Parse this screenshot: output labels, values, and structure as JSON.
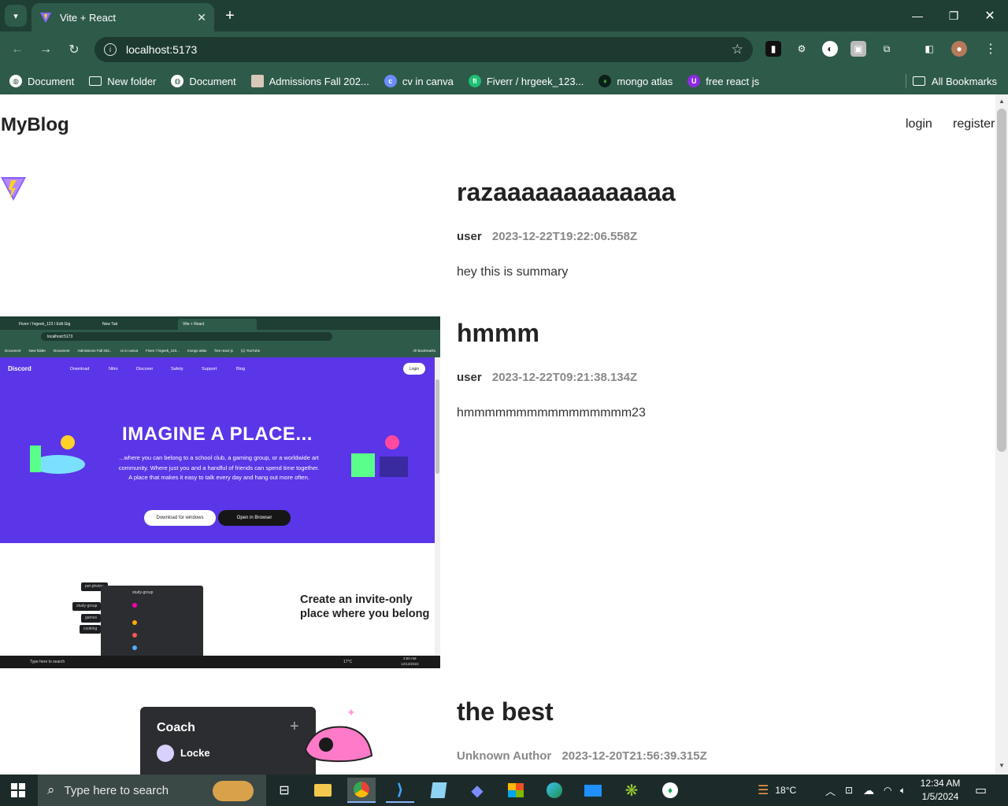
{
  "browser": {
    "tab_title": "Vite + React",
    "url": "localhost:5173",
    "bookmarks": [
      "Document",
      "New folder",
      "Document",
      "Admissions Fall 202...",
      "cv in canva",
      "Fiverr / hrgeek_123...",
      "mongo atlas",
      "free react js"
    ],
    "all_bookmarks": "All Bookmarks"
  },
  "page": {
    "logo": "MyBlog",
    "nav": {
      "login": "login",
      "register": "register"
    },
    "posts": [
      {
        "title": "razaaaaaaaaaaaaa",
        "author": "user",
        "date": "2023-12-22T19:22:06.558Z",
        "summary": "hey this is summary"
      },
      {
        "title": "hmmm",
        "author": "user",
        "date": "2023-12-22T09:21:38.134Z",
        "summary": "hmmmmmmmmmmmmmmmm23"
      },
      {
        "title": "the best",
        "author": "Unknown Author",
        "date": "2023-12-20T21:56:39.315Z",
        "summary": ""
      }
    ]
  },
  "embedded_screenshot": {
    "tabs": [
      "Fiverr / hrgeek_123 / Edit Gig",
      "New Tab",
      "Vite + React"
    ],
    "url": "localhost:5173",
    "bookmarks": [
      "Document",
      "New folder",
      "Document",
      "Admissions Fall 202...",
      "cv in canva",
      "Fiverr / hrgeek_123...",
      "mongo atlas",
      "free react js",
      "(1) YouTube",
      "All Bookmarks"
    ],
    "brand": "Discord",
    "nav": [
      "Download",
      "Nitro",
      "Discover",
      "Safety",
      "Support",
      "Blog"
    ],
    "login": "Login",
    "headline": "IMAGINE A PLACE...",
    "body": "...where you can belong to a school club, a gaming group, or a worldwide art community. Where just you and a handful of friends can spend time together. A place that makes it easy to talk every day and hang out more often.",
    "btn_download": "Download for windows",
    "btn_browser": "Open in Browser",
    "section2": "Create an invite-only place where you belong",
    "channels": [
      "pet-photos",
      "study-group",
      "games",
      "cooking"
    ],
    "panel_header": "study-group",
    "taskbar_search": "Type here to search",
    "taskbar_temp": "17°C",
    "taskbar_time": "3:50 AM",
    "taskbar_date": "12/14/2023"
  },
  "third_image": {
    "header": "Coach",
    "item": "Locke"
  },
  "taskbar": {
    "search_placeholder": "Type here to search",
    "temperature": "18°C",
    "time": "12:34 AM",
    "date": "1/5/2024"
  },
  "colors": {
    "chrome": "#2e5a4a",
    "tabstrip": "#1f3f34",
    "discord_blurple": "#5b35e8"
  }
}
